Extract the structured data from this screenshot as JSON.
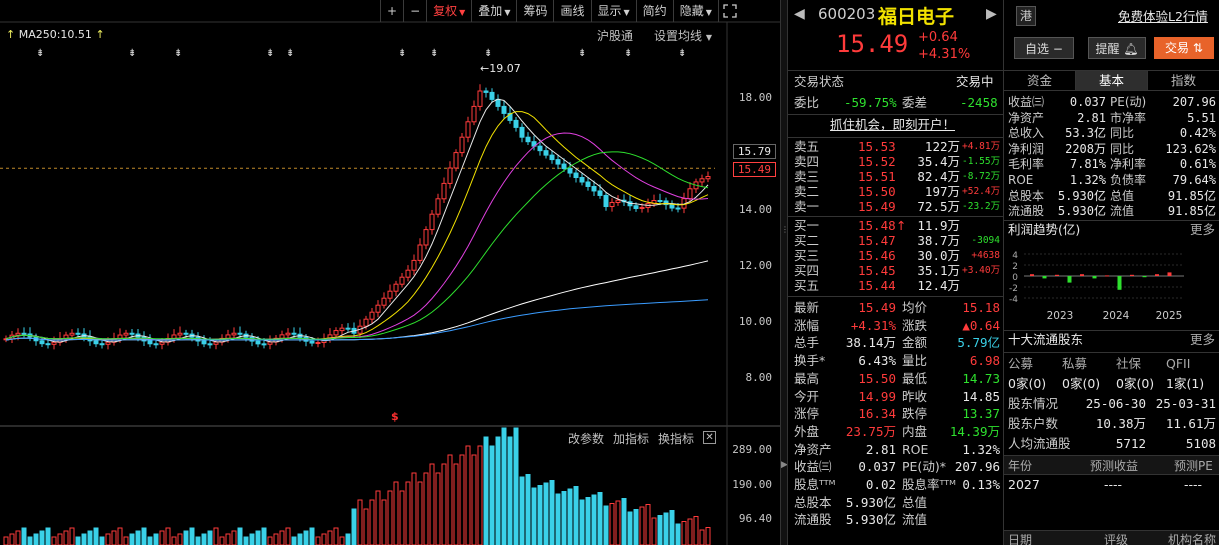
{
  "toolbar": {
    "plus": "+",
    "minus": "−",
    "items": [
      {
        "label": "复权",
        "caret": true,
        "active": true
      },
      {
        "label": "叠加",
        "caret": true
      },
      {
        "label": "筹码"
      },
      {
        "label": "画线"
      },
      {
        "label": "显示",
        "caret": true
      },
      {
        "label": "简约"
      },
      {
        "label": "隐藏",
        "caret": true
      }
    ]
  },
  "chart": {
    "ma_label": "MA250:10.51",
    "hk_connect": "沪股通",
    "ma_settings": "设置均线",
    "high_label": "19.07",
    "price_ticks": [
      "18.00",
      "16.00",
      "14.00",
      "12.00",
      "10.00",
      "8.00"
    ],
    "price_box_1": "15.79",
    "price_box_2": "15.49",
    "vol_ticks": [
      "289.00",
      "190.00",
      "96.40"
    ],
    "vol_head": [
      "改参数",
      "加指标",
      "换指标"
    ],
    "dollar_mark": "$",
    "star_glyph": "⇟"
  },
  "quote": {
    "code": "600203",
    "name": "福日电子",
    "hk": "港",
    "l2": "免费体验L2行情",
    "price": "15.49",
    "change": "+0.64",
    "change_pct": "+4.31%",
    "watchlist": "自选",
    "alert": "提醒",
    "trade": "交易",
    "status_label": "交易状态",
    "status_value": "交易中",
    "wb_label": "委比",
    "wb_value": "-59.75%",
    "wc_label": "委差",
    "wc_value": "-2458",
    "ad": "抓住机会，即刻开户！",
    "asks": [
      {
        "label": "卖五",
        "price": "15.53",
        "vol": "122万",
        "delta": "+4.81万"
      },
      {
        "label": "卖四",
        "price": "15.52",
        "vol": "35.4万",
        "delta": "-1.55万"
      },
      {
        "label": "卖三",
        "price": "15.51",
        "vol": "82.4万",
        "delta": "-8.72万"
      },
      {
        "label": "卖二",
        "price": "15.50",
        "vol": "197万",
        "delta": "+52.4万"
      },
      {
        "label": "卖一",
        "price": "15.49",
        "vol": "72.5万",
        "delta": "-23.2万"
      }
    ],
    "bids": [
      {
        "label": "买一",
        "price": "15.48",
        "vol": "11.9万",
        "delta": ""
      },
      {
        "label": "买二",
        "price": "15.47",
        "vol": "38.7万",
        "delta": "-3094"
      },
      {
        "label": "买三",
        "price": "15.46",
        "vol": "30.0万",
        "delta": "+4638"
      },
      {
        "label": "买四",
        "price": "15.45",
        "vol": "35.1万",
        "delta": "+3.40万"
      },
      {
        "label": "买五",
        "price": "15.44",
        "vol": "12.4万",
        "delta": ""
      }
    ],
    "bid1_arrow": "↑",
    "stats": [
      {
        "l1": "最新",
        "v1": "15.49",
        "c1": "red",
        "l2": "均价",
        "v2": "15.18",
        "c2": "red"
      },
      {
        "l1": "涨幅",
        "v1": "+4.31%",
        "c1": "red",
        "l2": "涨跌",
        "v2": "▲0.64",
        "c2": "red"
      },
      {
        "l1": "总手",
        "v1": "38.14万",
        "c1": "white",
        "l2": "金额",
        "v2": "5.79亿",
        "c2": "cyan"
      },
      {
        "l1": "换手*",
        "v1": "6.43%",
        "c1": "white",
        "l2": "量比",
        "v2": "6.98",
        "c2": "red"
      },
      {
        "l1": "最高",
        "v1": "15.50",
        "c1": "red",
        "l2": "最低",
        "v2": "14.73",
        "c2": "green"
      },
      {
        "l1": "今开",
        "v1": "14.99",
        "c1": "red",
        "l2": "昨收",
        "v2": "14.85",
        "c2": "white"
      },
      {
        "l1": "涨停",
        "v1": "16.34",
        "c1": "red",
        "l2": "跌停",
        "v2": "13.37",
        "c2": "green"
      },
      {
        "l1": "外盘",
        "v1": "23.75万",
        "c1": "red",
        "l2": "内盘",
        "v2": "14.39万",
        "c2": "green"
      },
      {
        "l1": "净资产",
        "v1": "2.81",
        "c1": "white",
        "l2": "ROE",
        "v2": "1.32%",
        "c2": "white"
      },
      {
        "l1": "收益㈢",
        "v1": "0.037",
        "c1": "white",
        "l2": "PE(动)*",
        "v2": "207.96",
        "c2": "white"
      },
      {
        "l1": "股息ᵀᵀᴹ",
        "v1": "0.02",
        "c1": "white",
        "l2": "股息率ᵀᵀᴹ",
        "v2": "0.13%",
        "c2": "white"
      },
      {
        "l1": "总股本",
        "v1": "5.930亿",
        "c1": "white",
        "l2": "总值",
        "v2": "",
        "c2": "white"
      },
      {
        "l1": "流通股",
        "v1": "5.930亿",
        "c1": "white",
        "l2": "流值",
        "v2": "",
        "c2": "white"
      }
    ]
  },
  "fund": {
    "tabs": [
      "资金",
      "基本",
      "指数"
    ],
    "active_tab": 1,
    "rows": [
      {
        "l1": "收益㈢",
        "v1": "0.037",
        "l2": "PE(动)",
        "v2": "207.96"
      },
      {
        "l1": "净资产",
        "v1": "2.81",
        "l2": "市净率",
        "v2": "5.51"
      },
      {
        "l1": "总收入",
        "v1": "53.3亿",
        "l2": "同比",
        "v2": "0.42%"
      },
      {
        "l1": "净利润",
        "v1": "2208万",
        "l2": "同比",
        "v2": "123.62%"
      },
      {
        "l1": "毛利率",
        "v1": "7.81%",
        "l2": "净利率",
        "v2": "0.61%"
      },
      {
        "l1": "ROE",
        "v1": "1.32%",
        "l2": "负债率",
        "v2": "79.64%"
      },
      {
        "l1": "总股本",
        "v1": "5.930亿",
        "l2": "总值",
        "v2": "91.85亿"
      },
      {
        "l1": "流通股",
        "v1": "5.930亿",
        "l2": "流值",
        "v2": "91.85亿"
      }
    ],
    "profit_title": "利润趋势(亿)",
    "more": "更多",
    "profit_y": [
      "4",
      "2",
      "0",
      "-2",
      "-4"
    ],
    "profit_years": [
      "2023",
      "2024",
      "2025"
    ],
    "profit_bars": [
      0.3,
      -0.4,
      0.2,
      -1.1,
      0.3,
      -0.4,
      0.1,
      -2.3,
      0.2,
      -0.2,
      0.3,
      0.6
    ],
    "holders_title": "十大流通股东",
    "holder_types": [
      "公募",
      "私募",
      "社保",
      "QFII"
    ],
    "holder_counts": [
      "0家(0)",
      "0家(0)",
      "0家(0)",
      "1家(1)"
    ],
    "holder_rows": [
      {
        "l": "股东情况",
        "v1": "25-06-30",
        "v2": "25-03-31"
      },
      {
        "l": "股东户数",
        "v1": "10.38万",
        "v2": "11.61万"
      },
      {
        "l": "人均流通股",
        "v1": "5712",
        "v2": "5108"
      }
    ],
    "fc_head": [
      "年份",
      "预测收益",
      "预测PE"
    ],
    "fc_row": [
      "2027",
      "----",
      "----"
    ],
    "rating_head": [
      "日期",
      "评级",
      "机构名称"
    ]
  }
}
